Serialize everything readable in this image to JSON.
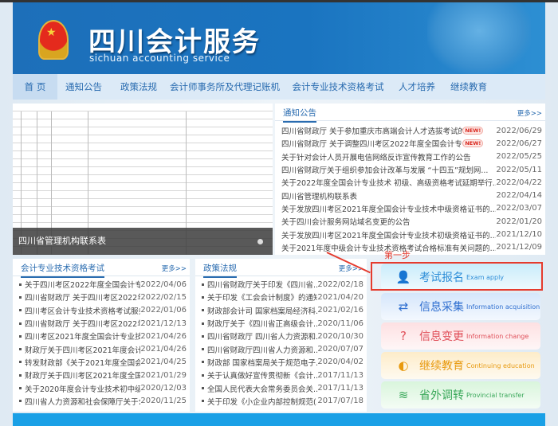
{
  "header": {
    "title": "四川会计服务",
    "subtitle": "sichuan accounting service"
  },
  "nav": [
    "首 页",
    "通知公告",
    "政策法规",
    "会计师事务所及代理记账机构",
    "会计专业技术资格考试",
    "人才培养",
    "继续教育"
  ],
  "slider": {
    "caption": "四川省管理机构联系表"
  },
  "notices": {
    "title": "通知公告",
    "more": "更多>>",
    "items": [
      {
        "text": "四川省财政厅 关于参加重庆市高端会计人才选拔考试的公告",
        "date": "2022/06/29",
        "badge": "NEW!"
      },
      {
        "text": "四川省财政厅 关于调整四川考区2022年度全国会计专业技术初...",
        "date": "2022/06/27",
        "badge": "NEW!"
      },
      {
        "text": "关于针对会计人员开展电信网络反诈宣传教育工作的公告",
        "date": "2022/05/25"
      },
      {
        "text": "四川省财政厅关于组织参加会计改革与发展 “十四五”规划网...",
        "date": "2022/05/11"
      },
      {
        "text": "关于2022年度全国会计专业技术 初级、高级资格考试延期举行...",
        "date": "2022/04/22"
      },
      {
        "text": "四川省管理机构联系表",
        "date": "2022/04/14"
      },
      {
        "text": "关于发放四川考区2021年度全国会计专业技术中级资格证书的...",
        "date": "2022/03/07"
      },
      {
        "text": "关于四川会计服务网站域名变更的公告",
        "date": "2022/01/20"
      },
      {
        "text": "关于发放四川考区2021年度全国会计专业技术初级资格证书的...",
        "date": "2021/12/10"
      },
      {
        "text": "关于2021年度中级会计专业技术资格考试合格标准有关问题的...",
        "date": "2021/12/09"
      }
    ]
  },
  "exams": {
    "title": "会计专业技术资格考试",
    "more": "更多>>",
    "items": [
      {
        "text": "关于四川考区2022年度全国会计专业...",
        "date": "2022/04/06"
      },
      {
        "text": "四川省财政厅 关于四川考区2022年度...",
        "date": "2022/02/15"
      },
      {
        "text": "四川考区会计专业技术资格考试服务事...",
        "date": "2022/01/06"
      },
      {
        "text": "四川省财政厅 关于四川考区2022年度...",
        "date": "2021/12/13"
      },
      {
        "text": "四川考区2021年度全国会计专业技术...",
        "date": "2021/04/26"
      },
      {
        "text": "财政厅关于四川考区2021年度会计初...",
        "date": "2021/04/26"
      },
      {
        "text": "转发财政部《关于2021年度全国会计...",
        "date": "2021/04/25"
      },
      {
        "text": "财政厅关于四川考区2021年度全国会...",
        "date": "2021/01/29"
      },
      {
        "text": "关于2020年度会计专业技术初中级考...",
        "date": "2020/12/03"
      },
      {
        "text": "四川省人力资源和社会保障厅关于公布...",
        "date": "2020/11/25"
      }
    ]
  },
  "policies": {
    "title": "政策法规",
    "more": "更多>>",
    "items": [
      {
        "text": "四川省财政厅关于印发《四川省...",
        "date": "2022/02/18"
      },
      {
        "text": "关于印发《工会会计制度》的通知",
        "date": "2021/04/20"
      },
      {
        "text": "财政部会计司 国家档案局经济科...",
        "date": "2021/02/16"
      },
      {
        "text": "财政厅关于《四川省正高级会计...",
        "date": "2020/11/06"
      },
      {
        "text": "四川省财政厅 四川省人力资源和...",
        "date": "2020/10/30"
      },
      {
        "text": "四川省财政厅四川省人力资源和...",
        "date": "2020/07/07"
      },
      {
        "text": "财政部 国家档案局关于规范电子...",
        "date": "2020/04/02"
      },
      {
        "text": "关于认真做好宣传贯彻新《会计...",
        "date": "2017/11/13"
      },
      {
        "text": "全国人民代表大会常务委员会关...",
        "date": "2017/11/13"
      },
      {
        "text": "关于印发《小企业内部控制规范(...",
        "date": "2017/07/18"
      }
    ]
  },
  "annotation": {
    "step": "第一步"
  },
  "services": [
    {
      "cn": "考试报名",
      "en": "Exam apply",
      "icon": "person-edit-icon",
      "color": "#2f8fd8",
      "bg": "#c9ecfb"
    },
    {
      "cn": "信息采集",
      "en": "Information acquisition",
      "icon": "signpost-icon",
      "color": "#2f6fd0",
      "bg": "#d5e6fb"
    },
    {
      "cn": "信息变更",
      "en": "Information change",
      "icon": "question-bubble-icon",
      "color": "#e0505a",
      "bg": "#fde0e2"
    },
    {
      "cn": "继续教育",
      "en": "Continuing education",
      "icon": "mouse-icon",
      "color": "#e89a10",
      "bg": "#fdecc9"
    },
    {
      "cn": "省外调转",
      "en": "Provincial transfer",
      "icon": "layers-icon",
      "color": "#3aa85a",
      "bg": "#d9f5dc"
    }
  ]
}
